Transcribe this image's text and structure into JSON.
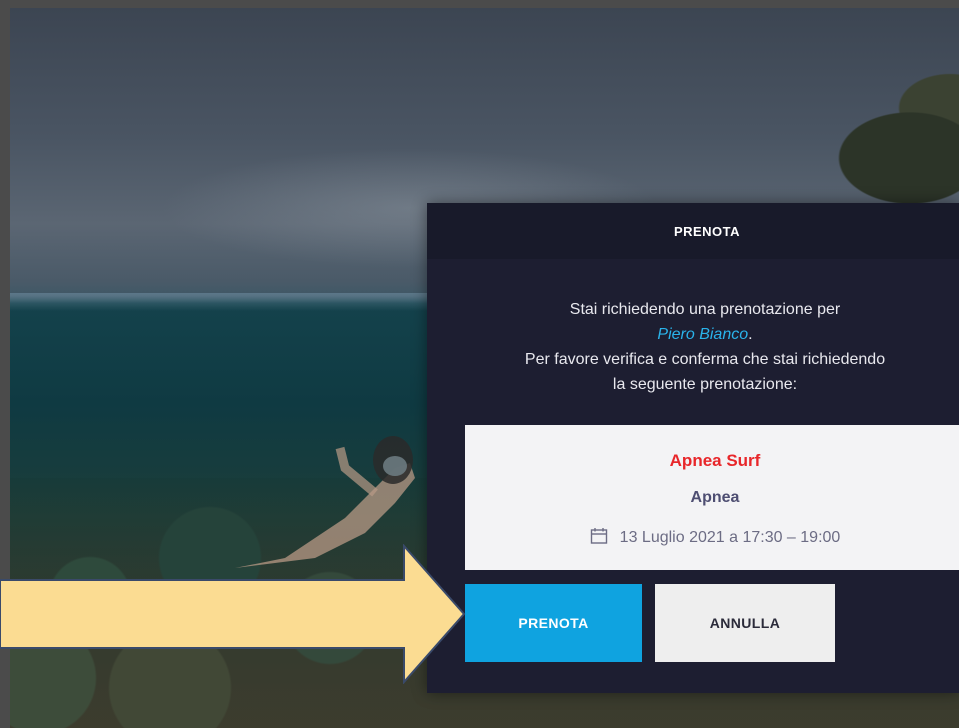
{
  "modal": {
    "title": "PRENOTA",
    "intro_line1": "Stai richiedendo una prenotazione per",
    "instructor_name": "Piero Bianco",
    "instructor_suffix": ".",
    "intro_line3": "Per favore verifica e conferma che stai richiedendo",
    "intro_line4": "la seguente prenotazione:",
    "booking": {
      "title": "Apnea Surf",
      "subtitle": "Apnea",
      "date_icon": "calendar-icon",
      "date": "13 Luglio 2021 a 17:30 – 19:00"
    },
    "buttons": {
      "confirm_label": "PRENOTA",
      "cancel_label": "ANNULLA"
    }
  },
  "annotation": {
    "arrow_icon": "arrow-right-icon",
    "arrow_color": "#fbdc92"
  },
  "colors": {
    "modal_bg": "#1d1e31",
    "primary": "#0fa3e0",
    "booking_title": "#e8262a",
    "instructor_link": "#2ab3ea"
  }
}
